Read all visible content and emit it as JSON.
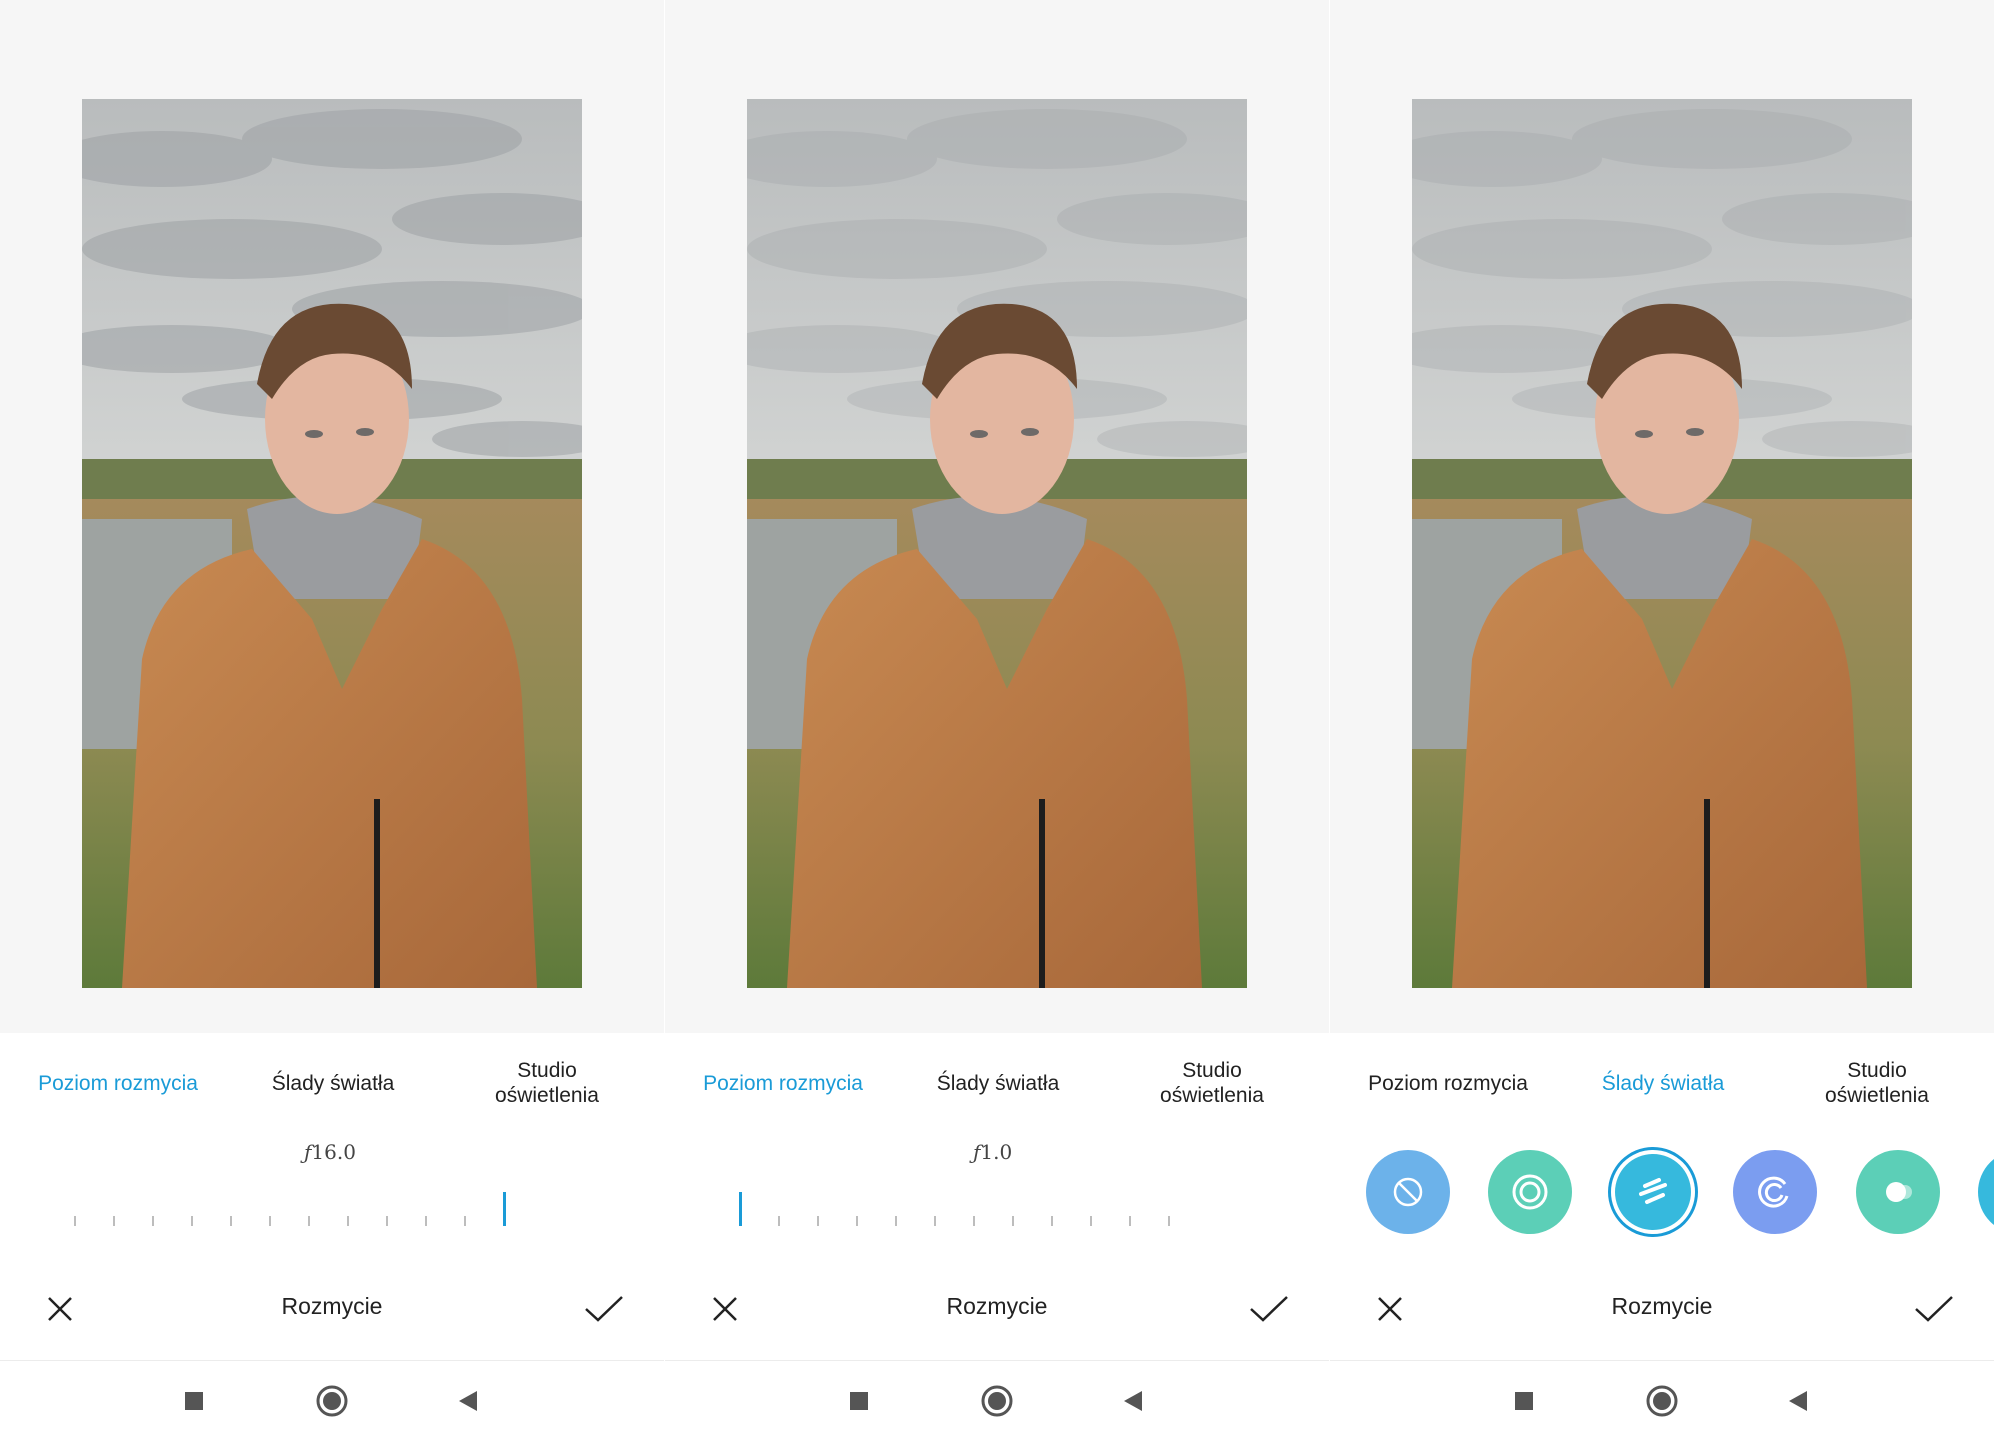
{
  "tabs": {
    "blur_level": "Poziom rozmycia",
    "light_trails": "Ślady światła",
    "studio_lighting": "Studio\noświetlenia"
  },
  "panels": [
    {
      "active_tab": "blur_level",
      "aperture_symbol": "ƒ",
      "aperture_value": "16.0",
      "slider_index": 11,
      "slider_ticks": 12
    },
    {
      "active_tab": "blur_level",
      "aperture_symbol": "ƒ",
      "aperture_value": "1.0",
      "slider_index": 0,
      "slider_ticks": 12
    },
    {
      "active_tab": "light_trails",
      "effects": [
        "off-icon",
        "ring-icon",
        "streaks-icon",
        "spiral-icon",
        "dot-icon",
        "partial-icon"
      ],
      "selected_effect_index": 2
    }
  ],
  "bottom_bar": {
    "title": "Rozmycie",
    "close_icon": "close-icon",
    "confirm_icon": "check-icon"
  },
  "nav": {
    "recent": "square-icon",
    "home": "circle-icon",
    "back": "triangle-back-icon"
  },
  "colors": {
    "accent": "#1a9bd7",
    "text": "#222222",
    "effect_blue": "#6cb2ea",
    "effect_teal": "#5ccfb7",
    "effect_cyan": "#36b9dd",
    "effect_violet": "#7b9df0"
  }
}
